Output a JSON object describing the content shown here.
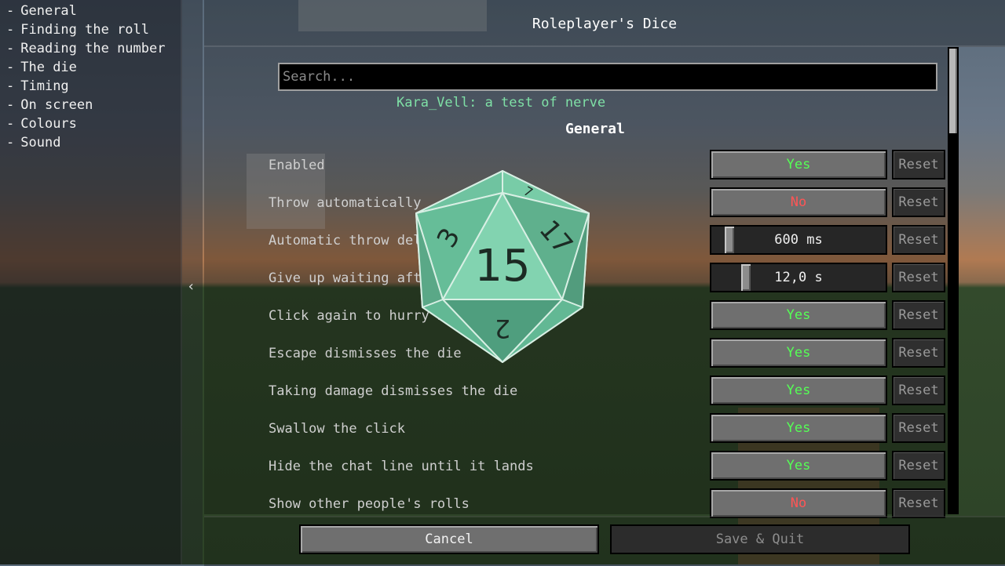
{
  "sidebar": {
    "items": [
      {
        "label": "General"
      },
      {
        "label": "Finding the roll"
      },
      {
        "label": "Reading the number"
      },
      {
        "label": "The die"
      },
      {
        "label": "Timing"
      },
      {
        "label": "On screen"
      },
      {
        "label": "Colours"
      },
      {
        "label": "Sound"
      }
    ],
    "dash": "-"
  },
  "collapse_glyph": "‹",
  "title": "Roleplayer's Dice",
  "search": {
    "placeholder": "Search...",
    "value": ""
  },
  "subtitle": "Kara_Vell: a test of nerve",
  "section": "General",
  "reset_label": "Reset",
  "options": [
    {
      "label": "Enabled",
      "value": "Yes",
      "kind": "yes"
    },
    {
      "label": "Throw automatically",
      "value": "No",
      "kind": "no"
    },
    {
      "label": "Automatic throw delay",
      "value": "600 ms",
      "kind": "slider",
      "level": 0.08
    },
    {
      "label": "Give up waiting after",
      "value": "12,0 s",
      "kind": "slider",
      "level": 0.18
    },
    {
      "label": "Click again to hurry it",
      "value": "Yes",
      "kind": "yes"
    },
    {
      "label": "Escape dismisses the die",
      "value": "Yes",
      "kind": "yes"
    },
    {
      "label": "Taking damage dismisses the die",
      "value": "Yes",
      "kind": "yes"
    },
    {
      "label": "Swallow the click",
      "value": "Yes",
      "kind": "yes"
    },
    {
      "label": "Hide the chat line until it lands",
      "value": "Yes",
      "kind": "yes"
    },
    {
      "label": "Show other people's rolls",
      "value": "No",
      "kind": "no"
    }
  ],
  "footer": {
    "cancel": "Cancel",
    "save_quit": "Save & Quit"
  },
  "die": {
    "result": "15",
    "faces": [
      "3",
      "17",
      "2",
      "7"
    ],
    "color": "#6fc3a0"
  },
  "colors": {
    "yes": "#55ff55",
    "no": "#ff5555",
    "subtitle": "#7fe0a6"
  }
}
